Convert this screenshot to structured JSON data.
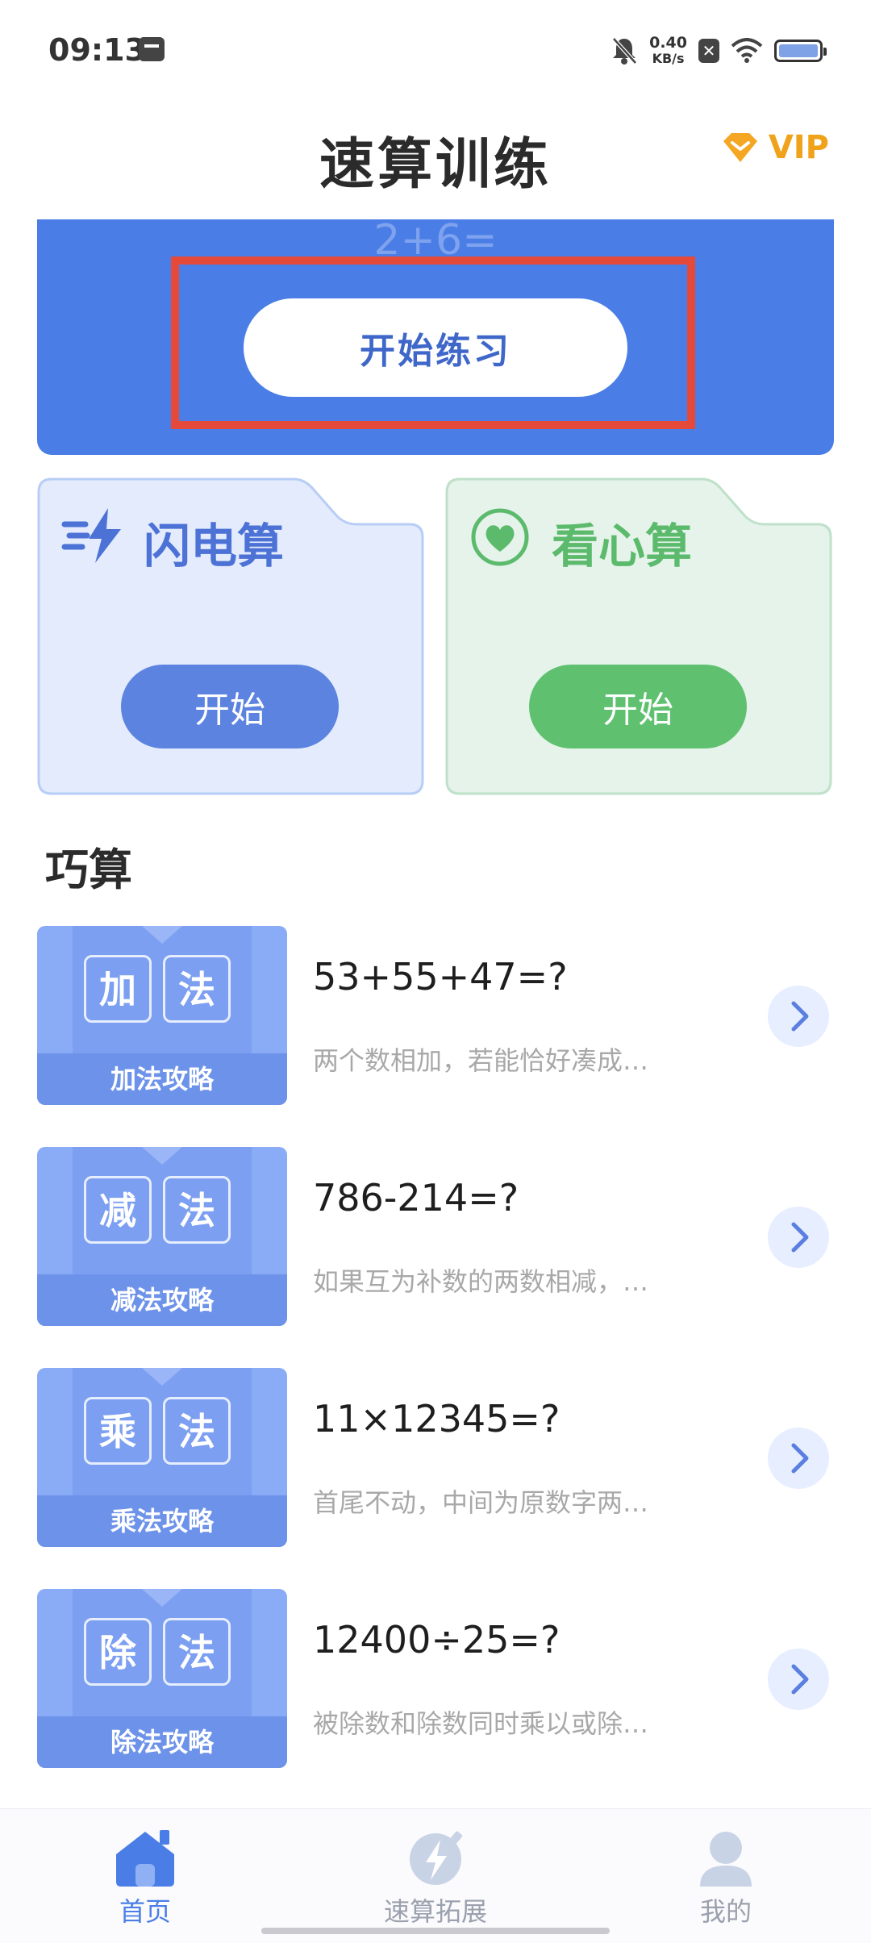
{
  "status_bar": {
    "time": "09:13",
    "speed_value": "0.40",
    "speed_unit": "KB/s",
    "close_badge": "✕"
  },
  "header": {
    "title": "速算训练",
    "vip_label": "VIP"
  },
  "banner": {
    "ghost_expression": "2+6=",
    "start_label": "开始练习"
  },
  "modes": [
    {
      "title": "闪电算",
      "button": "开始",
      "color": "#4c72d6"
    },
    {
      "title": "看心算",
      "button": "开始",
      "color": "#5cba6c"
    }
  ],
  "section": {
    "title": "巧算"
  },
  "strategies": [
    {
      "char1": "加",
      "char2": "法",
      "label": "加法攻略",
      "title": "53+55+47=?",
      "desc": "两个数相加，若能恰好凑成…"
    },
    {
      "char1": "减",
      "char2": "法",
      "label": "减法攻略",
      "title": "786-214=?",
      "desc": "如果互为补数的两数相减，…"
    },
    {
      "char1": "乘",
      "char2": "法",
      "label": "乘法攻略",
      "title": "11×12345=?",
      "desc": "首尾不动，中间为原数字两…"
    },
    {
      "char1": "除",
      "char2": "法",
      "label": "除法攻略",
      "title": "12400÷25=?",
      "desc": "被除数和除数同时乘以或除…"
    }
  ],
  "bottom_nav": [
    {
      "label": "首页",
      "active": true,
      "icon": "home-icon"
    },
    {
      "label": "速算拓展",
      "active": false,
      "icon": "lightning-icon"
    },
    {
      "label": "我的",
      "active": false,
      "icon": "profile-icon"
    }
  ],
  "colors": {
    "accent": "#4a7ee6",
    "highlight": "#e5493a",
    "vip": "#f0a21b"
  }
}
